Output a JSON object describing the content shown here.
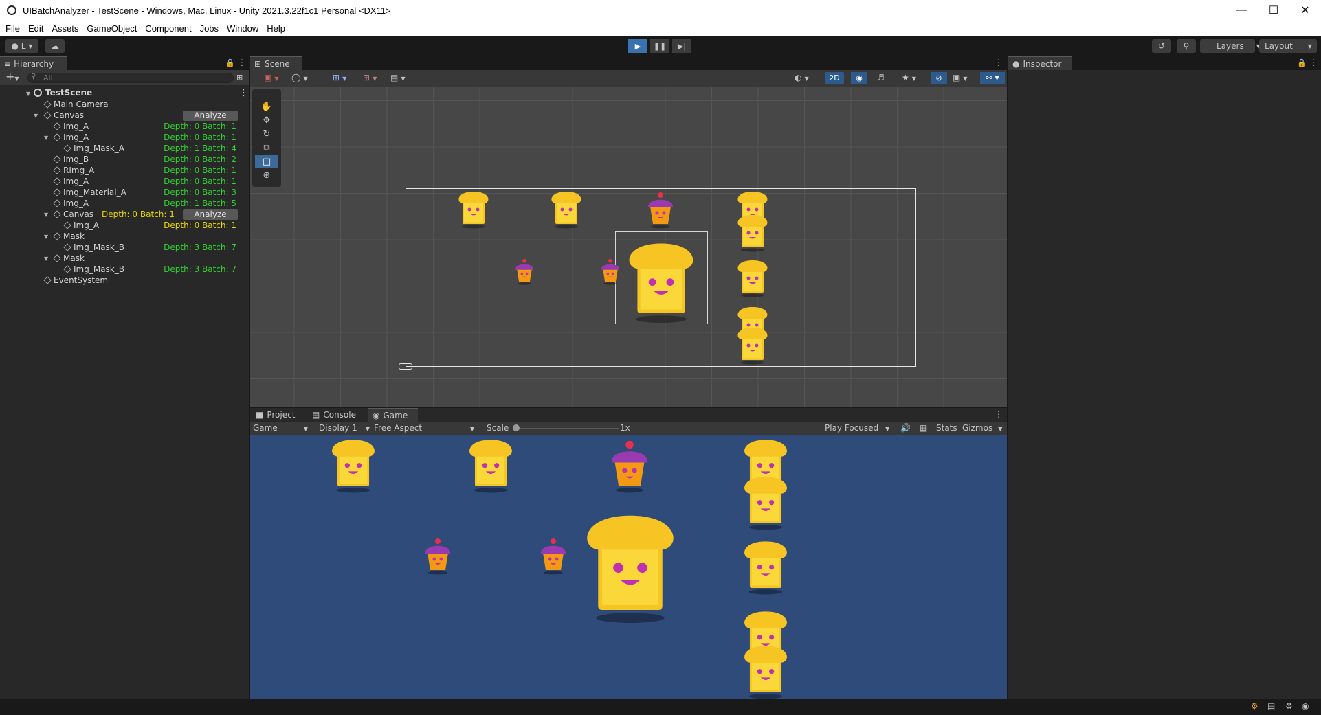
{
  "window": {
    "title": "UIBatchAnalyzer - TestScene - Windows, Mac, Linux - Unity 2021.3.22f1c1 Personal <DX11>"
  },
  "menu": [
    "File",
    "Edit",
    "Assets",
    "GameObject",
    "Component",
    "Jobs",
    "Window",
    "Help"
  ],
  "toolbar": {
    "account_label": "L",
    "layers_label": "Layers",
    "layout_label": "Layout"
  },
  "hierarchy": {
    "tab": "Hierarchy",
    "search_placeholder": "All",
    "scene_name": "TestScene",
    "analyze_label": "Analyze",
    "rows": [
      {
        "name": "Main Camera",
        "info": ""
      },
      {
        "name": "Canvas",
        "info": ""
      },
      {
        "name": "Img_A",
        "info": "Depth: 0 Batch: 1"
      },
      {
        "name": "Img_A",
        "info": "Depth: 0 Batch: 1"
      },
      {
        "name": "Img_Mask_A",
        "info": "Depth: 1 Batch: 4"
      },
      {
        "name": "Img_B",
        "info": "Depth: 0 Batch: 2"
      },
      {
        "name": "RImg_A",
        "info": "Depth: 0 Batch: 1"
      },
      {
        "name": "Img_A",
        "info": "Depth: 0 Batch: 1"
      },
      {
        "name": "Img_Material_A",
        "info": "Depth: 0 Batch: 3"
      },
      {
        "name": "Img_A",
        "info": "Depth: 1 Batch: 5"
      },
      {
        "name": "Canvas",
        "info": "Depth: 0 Batch: 1"
      },
      {
        "name": "Img_A",
        "info": "Depth: 0 Batch: 1"
      },
      {
        "name": "Mask",
        "info": ""
      },
      {
        "name": "Img_Mask_B",
        "info": "Depth: 3 Batch: 7"
      },
      {
        "name": "Mask",
        "info": ""
      },
      {
        "name": "Img_Mask_B",
        "info": "Depth: 3 Batch: 7"
      },
      {
        "name": "EventSystem",
        "info": ""
      }
    ]
  },
  "scene": {
    "tab": "Scene",
    "mode_2d": "2D"
  },
  "bottom_tabs": [
    "Project",
    "Console",
    "Game"
  ],
  "game": {
    "view_dropdown": "Game",
    "display_dropdown": "Display 1",
    "aspect_dropdown": "Free Aspect",
    "scale_label": "Scale",
    "scale_value": "1x",
    "play_mode_dropdown": "Play Focused",
    "stats_label": "Stats",
    "gizmos_label": "Gizmos"
  },
  "inspector": {
    "tab": "Inspector"
  },
  "colors": {
    "accent_play": "#3a72b0",
    "depth_green": "#30d030",
    "depth_yellow": "#e8d300",
    "game_bg": "#2f4b79"
  },
  "icons": [
    "unity-icon",
    "minimize-icon",
    "maximize-icon",
    "close-icon",
    "play-icon",
    "pause-icon",
    "step-icon",
    "history-icon",
    "search-icon",
    "lock-icon",
    "kebab-menu-icon",
    "cube-icon",
    "hand-tool-icon",
    "move-tool-icon",
    "rotate-tool-icon",
    "scale-tool-icon",
    "rect-tool-icon",
    "transform-tool-icon",
    "audio-icon"
  ]
}
